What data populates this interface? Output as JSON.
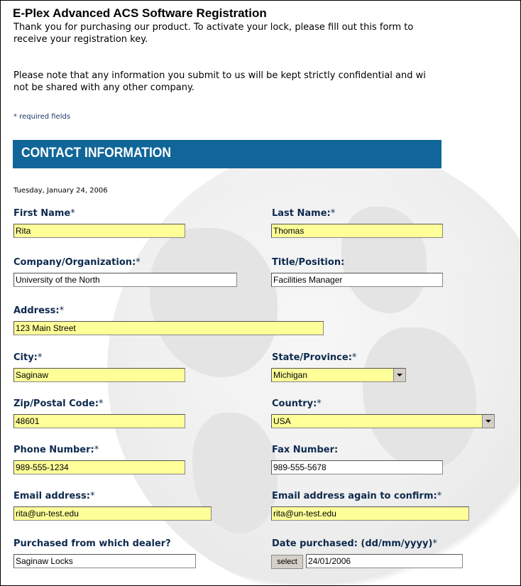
{
  "title": "E-Plex Advanced ACS Software Registration",
  "intro": {
    "line1": "Thank you for purchasing our product. To activate your lock, please fill out this form to",
    "line2": "receive your registration key.",
    "line3": "Please note that any information you submit to us will be kept strictly confidential and wi",
    "line4": "not be shared with any other company."
  },
  "required_note": "* required fields",
  "section_title": "CONTACT INFORMATION",
  "date": "Tuesday, January 24, 2006",
  "fields": {
    "first_name": {
      "label": "First Name",
      "star": "*",
      "value": "Rita"
    },
    "last_name": {
      "label": "Last Name:",
      "star": "*",
      "value": "Thomas"
    },
    "company": {
      "label": "Company/Organization:",
      "star": "*",
      "value": "University of the North"
    },
    "title_position": {
      "label": "Title/Position:",
      "value": "Facilities Manager"
    },
    "address": {
      "label": "Address:",
      "star": "*",
      "value": "123 Main Street"
    },
    "city": {
      "label": "City:",
      "star": "*",
      "value": "Saginaw"
    },
    "state": {
      "label": "State/Province:",
      "star": "*",
      "value": "Michigan"
    },
    "zip": {
      "label": "Zip/Postal Code:",
      "star": "*",
      "value": "48601"
    },
    "country": {
      "label": "Country:",
      "star": "*",
      "value": "USA"
    },
    "phone": {
      "label": "Phone Number:",
      "star": "*",
      "value": "989-555-1234"
    },
    "fax": {
      "label": "Fax Number:",
      "value": "989-555-5678"
    },
    "email": {
      "label": "Email address:",
      "star": "*",
      "value": "rita@un-test.edu"
    },
    "email_confirm": {
      "label": "Email address again to confirm:",
      "star": "*",
      "value": "rita@un-test.edu"
    },
    "dealer": {
      "label": "Purchased from which dealer?",
      "value": "Saginaw Locks"
    },
    "date_purchased": {
      "label": "Date purchased:  (dd/mm/yyyy)",
      "star": "*",
      "value": "24/01/2006",
      "button": "select"
    }
  },
  "colors": {
    "banner": "#116699",
    "required_field": "#ffff99",
    "label": "#0e2a4e"
  }
}
